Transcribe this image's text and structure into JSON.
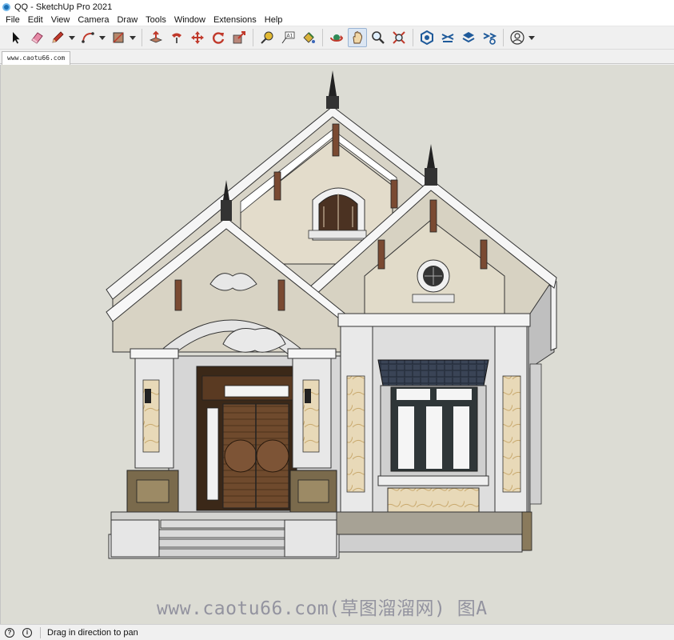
{
  "window": {
    "title": "QQ - SketchUp Pro 2021"
  },
  "menu": [
    "File",
    "Edit",
    "View",
    "Camera",
    "Draw",
    "Tools",
    "Window",
    "Extensions",
    "Help"
  ],
  "toolbar": {
    "tools": [
      {
        "name": "select-tool",
        "icon": "arrow-cursor-icon"
      },
      {
        "name": "eraser-tool",
        "icon": "eraser-icon"
      },
      {
        "name": "line-tool",
        "icon": "pencil-icon",
        "dropdown": true
      },
      {
        "name": "arc-tool",
        "icon": "arc-icon",
        "dropdown": true
      },
      {
        "name": "shape-tool",
        "icon": "rectangle-icon",
        "dropdown": true
      },
      {
        "name": "push-pull-tool",
        "icon": "push-pull-icon"
      },
      {
        "name": "follow-me-tool",
        "icon": "follow-me-icon"
      },
      {
        "name": "move-tool",
        "icon": "move-icon"
      },
      {
        "name": "rotate-tool",
        "icon": "rotate-icon"
      },
      {
        "name": "scale-tool",
        "icon": "scale-icon"
      },
      {
        "name": "tape-measure-tool",
        "icon": "tape-measure-icon"
      },
      {
        "name": "text-tool",
        "icon": "text-icon"
      },
      {
        "name": "paint-bucket-tool",
        "icon": "paint-bucket-icon"
      },
      {
        "name": "orbit-tool",
        "icon": "orbit-icon"
      },
      {
        "name": "pan-tool",
        "icon": "pan-hand-icon",
        "active": true
      },
      {
        "name": "zoom-tool",
        "icon": "zoom-icon"
      },
      {
        "name": "zoom-extents-tool",
        "icon": "zoom-extents-icon"
      },
      {
        "name": "warehouse-tool",
        "icon": "3d-warehouse-icon"
      },
      {
        "name": "extension-warehouse-tool",
        "icon": "extension-warehouse-icon"
      },
      {
        "name": "layout-tool",
        "icon": "send-to-layout-icon"
      },
      {
        "name": "extension-manager-tool",
        "icon": "extension-manager-icon"
      },
      {
        "name": "account-tool",
        "icon": "account-icon",
        "dropdown": true
      }
    ]
  },
  "scene_tab": {
    "label": "www.caotu66.com"
  },
  "viewport": {
    "watermark": "www.caotu66.com(草图溜溜网) 图A",
    "background": "#dcdcd4"
  },
  "status": {
    "text": "Drag in direction to pan"
  }
}
